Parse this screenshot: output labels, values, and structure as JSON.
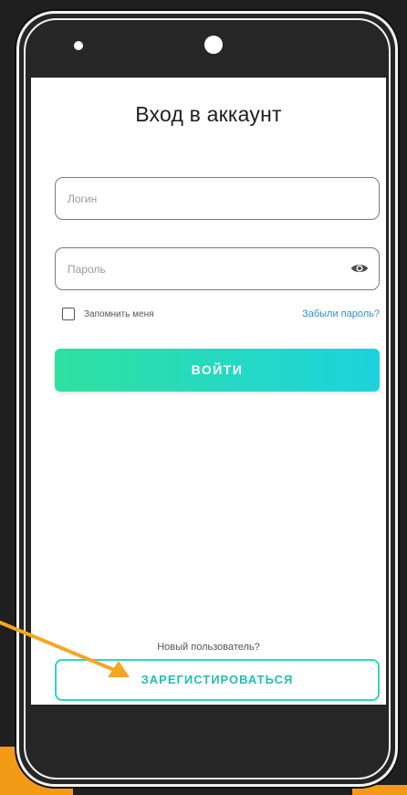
{
  "title": "Вход в аккаунт",
  "login_field": {
    "placeholder": "Логин"
  },
  "password_field": {
    "placeholder": "Пароль",
    "icon": "eye-icon"
  },
  "remember_me": {
    "label": "Запомнить меня",
    "checked": false
  },
  "forgot_password": "Забыли пароль?",
  "login_button": "ВОЙТИ",
  "new_user_text": "Новый пользователь?",
  "register_button": "ЗАРЕГИСТИРОВАТЬСЯ",
  "colors": {
    "accent_teal": "#24d8c6",
    "accent_green": "#2fe0a0",
    "link_blue": "#2f8fc0",
    "arrow_orange": "#f5a623"
  }
}
